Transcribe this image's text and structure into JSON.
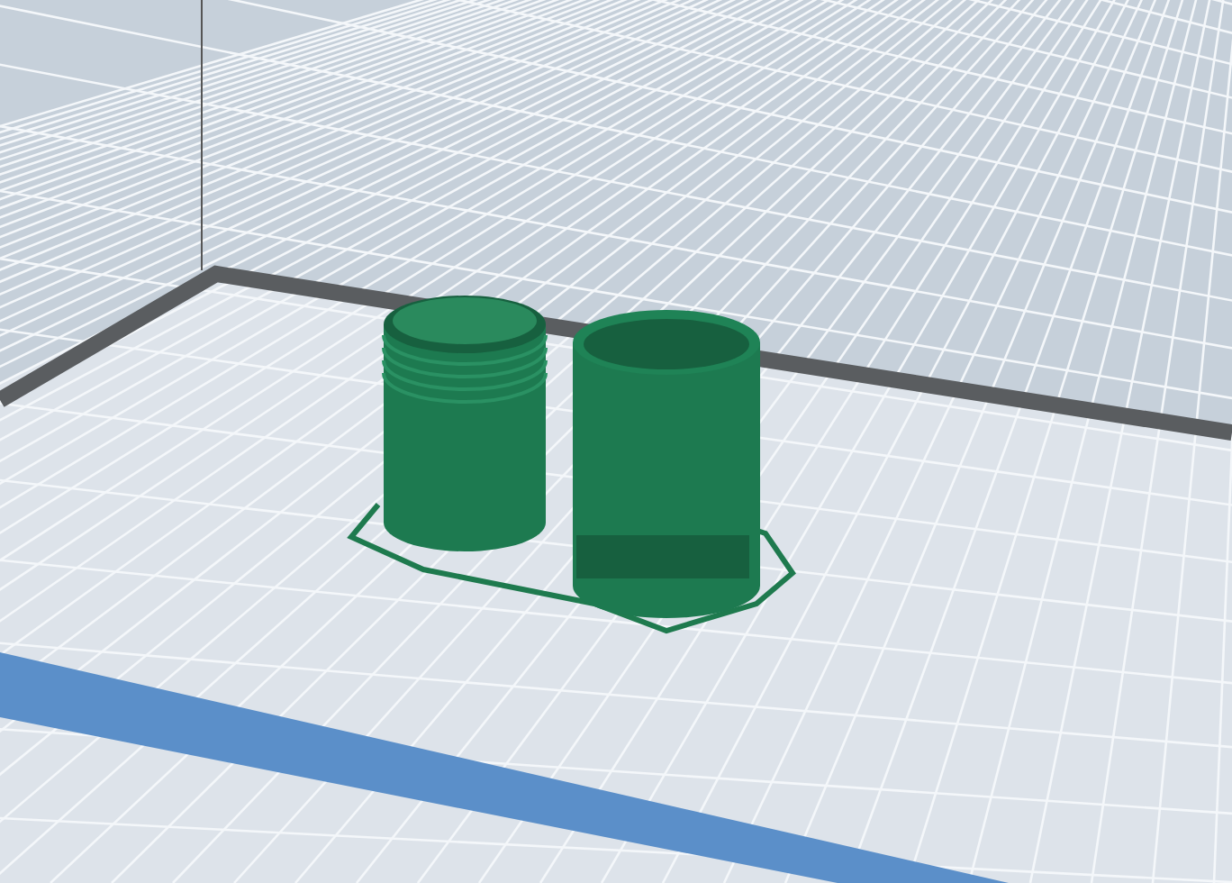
{
  "scene": {
    "objects": [
      {
        "kind": "threaded-jar"
      },
      {
        "kind": "threaded-cap"
      }
    ]
  }
}
